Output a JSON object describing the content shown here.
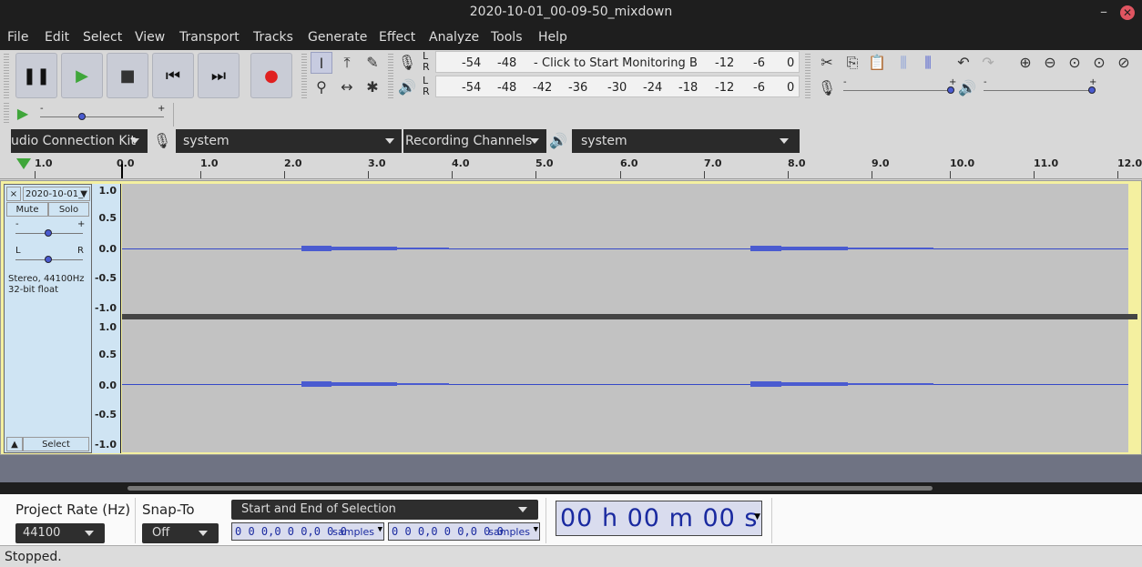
{
  "window": {
    "title": "2020-10-01_00-09-50_mixdown",
    "minimize": "–",
    "close": "✕"
  },
  "menu": [
    "File",
    "Edit",
    "Select",
    "View",
    "Transport",
    "Tracks",
    "Generate",
    "Effect",
    "Analyze",
    "Tools",
    "Help"
  ],
  "transport": {
    "buttons": [
      {
        "name": "pause-button",
        "glyph": "❚❚",
        "color": "#111111"
      },
      {
        "name": "play-button",
        "glyph": "▶",
        "color": "#3fa63a"
      },
      {
        "name": "stop-button",
        "glyph": "■",
        "color": "#333333"
      },
      {
        "name": "skip-start-button",
        "glyph": "⏮",
        "color": "#111111"
      },
      {
        "name": "skip-end-button",
        "glyph": "⏭",
        "color": "#111111"
      },
      {
        "name": "record-button",
        "glyph": "●",
        "color": "#e02020"
      }
    ]
  },
  "tools": {
    "row1": [
      "I",
      "⤒",
      "✎"
    ],
    "row2": [
      "⚲",
      "↔",
      "✱"
    ]
  },
  "meters": {
    "record": {
      "channels": "L\nR",
      "ticks": [
        "-54",
        "-48",
        "-",
        "Click to Start Monitoring",
        "B",
        "-12",
        "-6",
        "0"
      ]
    },
    "playback": {
      "channels": "L\nR",
      "ticks": [
        "-54",
        "-48",
        "-42",
        "-36",
        "-30",
        "-24",
        "-18",
        "-12",
        "-6",
        "0"
      ]
    }
  },
  "edit_tools": [
    "✂",
    "⎘",
    "📋",
    "⫼",
    "⫼",
    "↶",
    "↷"
  ],
  "zoom_tools": [
    "⊕",
    "⊖",
    "⊙",
    "⊙",
    "⊘"
  ],
  "mixer": {
    "record_icon": "mic-icon",
    "playback_icon": "speaker-icon",
    "minus": "-",
    "plus": "+"
  },
  "play_at_speed": {
    "minus": "-",
    "plus": "+"
  },
  "devices": {
    "host": "udio Connection Kit",
    "recording_device": "system",
    "recording_channels": "Recording Channels",
    "playback_device": "system"
  },
  "timeline": {
    "ticks": [
      "1.0",
      "0.0",
      "1.0",
      "2.0",
      "3.0",
      "4.0",
      "5.0",
      "6.0",
      "7.0",
      "8.0",
      "9.0",
      "10.0",
      "11.0",
      "12.0"
    ]
  },
  "track": {
    "name": "2020-10-01_",
    "mute": "Mute",
    "solo": "Solo",
    "gain_minus": "-",
    "gain_plus": "+",
    "pan_left": "L",
    "pan_right": "R",
    "info_line1": "Stereo, 44100Hz",
    "info_line2": "32-bit float",
    "select": "Select",
    "collapse": "▲",
    "close": "×",
    "vscale": [
      "1.0",
      "0.5",
      "0.0",
      "-0.5",
      "-1.0"
    ]
  },
  "selection_bar": {
    "project_rate_label": "Project Rate (Hz)",
    "project_rate": "44100",
    "snap_label": "Snap-To",
    "snap_value": "Off",
    "selection_mode": "Start and End of Selection",
    "start": "0 0 0,0 0 0,0 0 0",
    "end": "0 0 0,0 0 0,0 0 0",
    "unit": "samples",
    "time_display": "00 h 00 m 00 s"
  },
  "status": "Stopped."
}
